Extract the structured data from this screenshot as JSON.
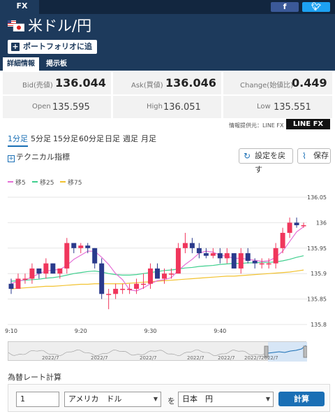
{
  "header": {
    "tab_label": "FX",
    "facebook_icon": "facebook-icon",
    "twitter_icon": "twitter-icon",
    "pair_title": "米ドル/円",
    "portfolio_button": "ポートフォリオに追加"
  },
  "tabs": [
    {
      "label": "詳細情報",
      "active": true
    },
    {
      "label": "掲示板",
      "active": false
    }
  ],
  "quote": {
    "bid_label": "Bid(売値)",
    "bid_value": "136.044",
    "ask_label": "Ask(買値)",
    "ask_value": "136.046",
    "change_label": "Change(始値比)",
    "change_value": "0.449",
    "open_label": "Open",
    "open_value": "135.595",
    "high_label": "High",
    "high_value": "136.051",
    "low_label": "Low",
    "low_value": "135.551"
  },
  "periods": [
    {
      "label": "1分足",
      "active": true
    },
    {
      "label": "5分足",
      "active": false
    },
    {
      "label": "15分足",
      "active": false
    },
    {
      "label": "60分足",
      "active": false
    },
    {
      "label": "日足",
      "active": false
    },
    {
      "label": "週足",
      "active": false
    },
    {
      "label": "月足",
      "active": false
    }
  ],
  "provider": {
    "text": "情報提供元：LINE FX",
    "logo": "LINE FX"
  },
  "toolbar": {
    "indicator_label": "テクニカル指標",
    "reset_label": "設定を戻す",
    "save_label": "保存"
  },
  "legend": [
    {
      "name": "移5",
      "color": "#e56fd6"
    },
    {
      "name": "移25",
      "color": "#3fcf8e"
    },
    {
      "name": "移75",
      "color": "#f2c230"
    }
  ],
  "colors": {
    "up": "#f0365c",
    "down": "#2a3a8c",
    "accent": "#1a6fb5",
    "header": "#1d3a5c"
  },
  "chart_data": {
    "type": "candlestick",
    "ylim": [
      135.8,
      136.05
    ],
    "y_ticks": [
      "136.05",
      "136",
      "135.95",
      "135.9",
      "135.85",
      "135.8"
    ],
    "x_ticks": [
      "9:10",
      "9:20",
      "9:30",
      "9:40"
    ],
    "candles": [
      [
        135.88,
        135.89,
        135.86,
        135.87
      ],
      [
        135.87,
        135.9,
        135.87,
        135.89
      ],
      [
        135.89,
        135.9,
        135.88,
        135.89
      ],
      [
        135.89,
        135.92,
        135.88,
        135.91
      ],
      [
        135.91,
        135.91,
        135.89,
        135.9
      ],
      [
        135.9,
        135.93,
        135.89,
        135.92
      ],
      [
        135.92,
        135.92,
        135.9,
        135.9
      ],
      [
        135.9,
        135.91,
        135.89,
        135.91
      ],
      [
        135.91,
        135.97,
        135.9,
        135.96
      ],
      [
        135.96,
        135.96,
        135.94,
        135.95
      ],
      [
        135.95,
        135.96,
        135.94,
        135.955
      ],
      [
        135.955,
        135.96,
        135.94,
        135.95
      ],
      [
        135.95,
        135.95,
        135.91,
        135.92
      ],
      [
        135.92,
        135.93,
        135.85,
        135.86
      ],
      [
        135.86,
        135.87,
        135.83,
        135.86
      ],
      [
        135.86,
        135.88,
        135.85,
        135.87
      ],
      [
        135.87,
        135.88,
        135.86,
        135.87
      ],
      [
        135.87,
        135.88,
        135.86,
        135.87
      ],
      [
        135.87,
        135.89,
        135.86,
        135.88
      ],
      [
        135.88,
        135.9,
        135.87,
        135.88
      ],
      [
        135.88,
        135.92,
        135.87,
        135.91
      ],
      [
        135.91,
        135.92,
        135.89,
        135.89
      ],
      [
        135.89,
        135.91,
        135.88,
        135.9
      ],
      [
        135.9,
        135.91,
        135.89,
        135.9
      ],
      [
        135.9,
        135.96,
        135.9,
        135.95
      ],
      [
        135.95,
        135.98,
        135.94,
        135.96
      ],
      [
        135.96,
        135.97,
        135.94,
        135.95
      ],
      [
        135.95,
        135.96,
        135.93,
        135.94
      ],
      [
        135.94,
        135.95,
        135.93,
        135.935
      ],
      [
        135.935,
        135.95,
        135.93,
        135.94
      ],
      [
        135.94,
        135.95,
        135.92,
        135.93
      ],
      [
        135.93,
        135.95,
        135.92,
        135.94
      ],
      [
        135.94,
        135.94,
        135.91,
        135.91
      ],
      [
        135.91,
        135.95,
        135.9,
        135.94
      ],
      [
        135.94,
        135.95,
        135.92,
        135.925
      ],
      [
        135.925,
        135.93,
        135.91,
        135.92
      ],
      [
        135.92,
        135.93,
        135.91,
        135.92
      ],
      [
        135.92,
        135.93,
        135.91,
        135.92
      ],
      [
        135.92,
        135.96,
        135.91,
        135.95
      ],
      [
        135.95,
        135.99,
        135.94,
        135.98
      ],
      [
        135.98,
        136.01,
        135.97,
        136.0
      ],
      [
        136.0,
        136.01,
        135.99,
        135.995
      ],
      [
        135.995,
        136.0,
        135.99,
        135.995
      ]
    ],
    "ma5": [
      135.88,
      135.885,
      135.888,
      135.893,
      135.9,
      135.905,
      135.907,
      135.908,
      135.916,
      135.928,
      135.936,
      135.944,
      135.944,
      135.932,
      135.918,
      135.9,
      135.888,
      135.868,
      135.866,
      135.872,
      135.88,
      135.886,
      135.888,
      135.892,
      135.906,
      135.918,
      135.928,
      135.94,
      135.944,
      135.942,
      135.936,
      135.934,
      135.93,
      135.93,
      135.928,
      135.926,
      135.924,
      135.925,
      135.932,
      135.944,
      135.963,
      135.982,
      135.992
    ],
    "ma25": [
      135.885,
      135.886,
      135.887,
      135.888,
      135.889,
      135.891,
      135.892,
      135.894,
      135.897,
      135.9,
      135.902,
      135.904,
      135.905,
      135.903,
      135.9,
      135.898,
      135.897,
      135.897,
      135.898,
      135.9,
      135.902,
      135.904,
      135.906,
      135.907,
      135.909,
      135.911,
      135.912,
      135.914,
      135.915,
      135.916,
      135.918,
      135.919,
      135.92,
      135.92,
      135.921,
      135.921,
      135.922,
      135.922,
      135.923,
      135.925,
      135.928,
      135.932,
      135.935
    ],
    "ma75": [
      135.87,
      135.871,
      135.872,
      135.873,
      135.874,
      135.875,
      135.875,
      135.876,
      135.877,
      135.878,
      135.879,
      135.879,
      135.88,
      135.88,
      135.88,
      135.88,
      135.88,
      135.881,
      135.882,
      135.883,
      135.884,
      135.885,
      135.886,
      135.887,
      135.888,
      135.889,
      135.89,
      135.891,
      135.892,
      135.893,
      135.894,
      135.895,
      135.895,
      135.896,
      135.897,
      135.898,
      135.899,
      135.9,
      135.901,
      135.902,
      135.903,
      135.905,
      135.907
    ]
  },
  "navigator": {
    "labels": [
      "2022/7",
      "2022/7",
      "2022/7",
      "2022/7",
      "2022/7",
      "2022/7",
      "2022/7"
    ]
  },
  "calculator": {
    "title": "為替レート計算",
    "amount": "1",
    "from_currency": "アメリカ　ドル",
    "connector": "を",
    "to_currency": "日本　円",
    "button_label": "計算"
  }
}
